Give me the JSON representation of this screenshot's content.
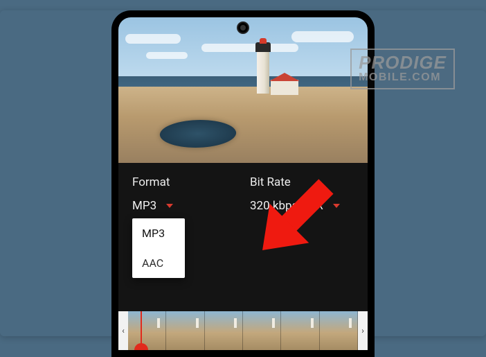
{
  "controls": {
    "format": {
      "label": "Format",
      "value": "MP3",
      "options": [
        "MP3",
        "AAC"
      ]
    },
    "bitrate": {
      "label": "Bit Rate",
      "value": "320 kbps CBR"
    }
  },
  "timeline": {
    "prev_glyph": "‹",
    "next_glyph": "›",
    "thumb_count": 6
  },
  "watermark": {
    "line1": "PRODIGE",
    "line2": "MOBILE.COM"
  },
  "colors": {
    "accent": "#e12a1c",
    "bg": "#141414",
    "page": "#4a6a82"
  }
}
